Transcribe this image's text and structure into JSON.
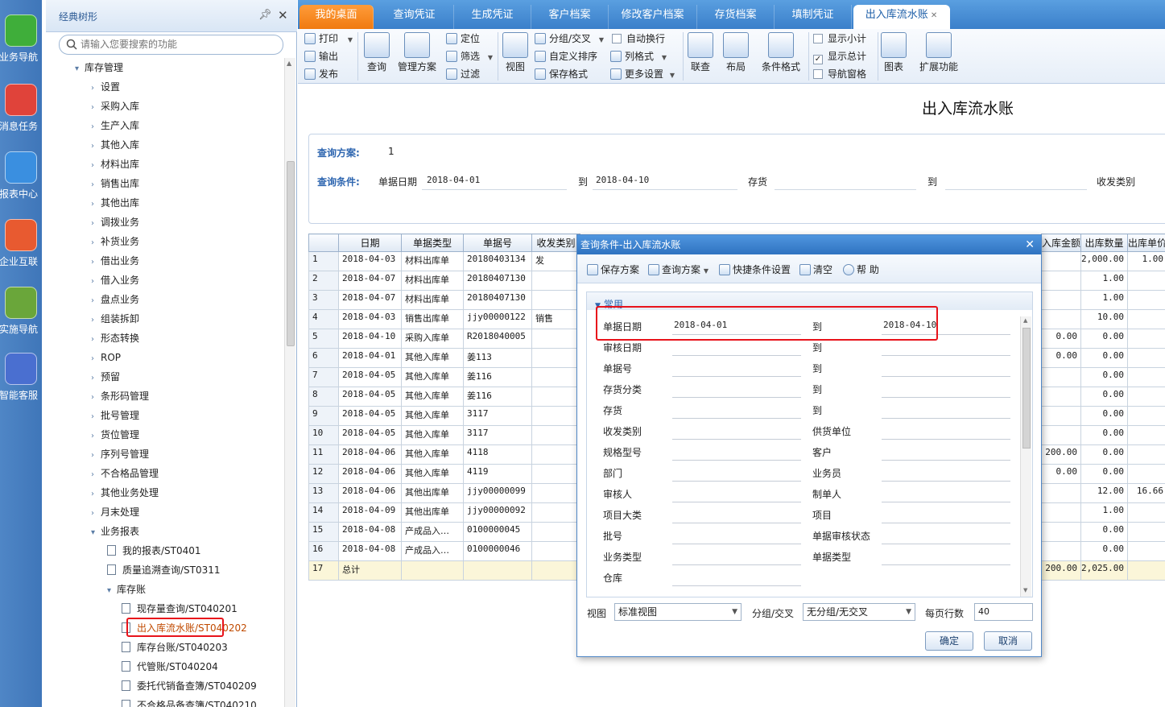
{
  "farleft": [
    {
      "label": "业务导航",
      "icon": "grid-icon",
      "color": "#3fae3a"
    },
    {
      "label": "消息任务",
      "icon": "mail-icon",
      "color": "#e0433a"
    },
    {
      "label": "报表中心",
      "icon": "report-icon",
      "color": "#3a8fe0"
    },
    {
      "label": "企业互联",
      "icon": "link-icon",
      "color": "#e85a30"
    },
    {
      "label": "实施导航",
      "icon": "compass-icon",
      "color": "#6aa63a"
    },
    {
      "label": "智能客服",
      "icon": "headset-icon",
      "color": "#4a6fd0"
    }
  ],
  "tree": {
    "title": "经典树形",
    "search_placeholder": "请输入您要搜索的功能",
    "root": "库存管理",
    "items": [
      "设置",
      "采购入库",
      "生产入库",
      "其他入库",
      "材料出库",
      "销售出库",
      "其他出库",
      "调拨业务",
      "补货业务",
      "借出业务",
      "借入业务",
      "盘点业务",
      "组装拆卸",
      "形态转换",
      "ROP",
      "预留",
      "条形码管理",
      "批号管理",
      "货位管理",
      "序列号管理",
      "不合格品管理",
      "其他业务处理",
      "月末处理"
    ],
    "reports": "业务报表",
    "report_items": [
      "我的报表/ST0401",
      "质量追溯查询/ST0311"
    ],
    "ledger": "库存账",
    "ledger_items": [
      "现存量查询/ST040201",
      "出入库流水账/ST040202",
      "库存台账/ST040203",
      "代管账/ST040204",
      "委托代销备查簿/ST040209",
      "不合格品备查簿/ST040210"
    ]
  },
  "tabs": [
    "我的桌面",
    "查询凭证",
    "生成凭证",
    "客户档案",
    "修改客户档案",
    "存货档案",
    "填制凭证",
    "出入库流水账"
  ],
  "ribbon": {
    "print": "打印",
    "export": "输出",
    "publish": "发布",
    "query": "查询",
    "manage_scheme": "管理方案",
    "locate": "定位",
    "filter": "筛选",
    "filter2": "过滤",
    "view": "视图",
    "group": "分组/交叉",
    "custom_sort": "自定义排序",
    "save_format": "保存格式",
    "auto_wrap": "自动换行",
    "col_format": "列格式",
    "more_settings": "更多设置",
    "link_query": "联查",
    "layout": "布局",
    "cond_format": "条件格式",
    "show_subtotal": "显示小计",
    "show_total": "显示总计",
    "nav_pane": "导航窗格",
    "chart": "图表",
    "extend": "扩展功能"
  },
  "page_title": "出入库流水账",
  "query": {
    "scheme_label": "查询方案:",
    "scheme_value": "1",
    "cond_label": "查询条件:",
    "date_label": "单据日期",
    "date_from": "2018-04-01",
    "to": "到",
    "date_to": "2018-04-10",
    "inv_label": "存货",
    "to2": "到",
    "type_label": "收发类别"
  },
  "grid": {
    "headers": [
      "",
      "日期",
      "单据类型",
      "单据号",
      "收发类别"
    ],
    "right_headers": [
      "入库金额",
      "出库数量",
      "出库单价"
    ],
    "rows": [
      {
        "n": "1",
        "date": "2018-04-03",
        "type": "材料出库单",
        "no": "20180403134",
        "cat": "发",
        "amt": "",
        "qty": "2,000.00",
        "price": "1.00"
      },
      {
        "n": "2",
        "date": "2018-04-07",
        "type": "材料出库单",
        "no": "20180407130",
        "cat": "",
        "amt": "",
        "qty": "1.00",
        "price": ""
      },
      {
        "n": "3",
        "date": "2018-04-07",
        "type": "材料出库单",
        "no": "20180407130",
        "cat": "",
        "amt": "",
        "qty": "1.00",
        "price": ""
      },
      {
        "n": "4",
        "date": "2018-04-03",
        "type": "销售出库单",
        "no": "jjy00000122",
        "cat": "销售",
        "amt": "",
        "qty": "10.00",
        "price": ""
      },
      {
        "n": "5",
        "date": "2018-04-10",
        "type": "采购入库单",
        "no": "R2018040005",
        "cat": "",
        "amt": "0.00",
        "qty": "0.00",
        "price": ""
      },
      {
        "n": "6",
        "date": "2018-04-01",
        "type": "其他入库单",
        "no": "姜113",
        "cat": "",
        "amt": "0.00",
        "qty": "0.00",
        "price": ""
      },
      {
        "n": "7",
        "date": "2018-04-05",
        "type": "其他入库单",
        "no": "姜116",
        "cat": "",
        "amt": "",
        "qty": "0.00",
        "price": ""
      },
      {
        "n": "8",
        "date": "2018-04-05",
        "type": "其他入库单",
        "no": "姜116",
        "cat": "",
        "amt": "",
        "qty": "0.00",
        "price": ""
      },
      {
        "n": "9",
        "date": "2018-04-05",
        "type": "其他入库单",
        "no": "3117",
        "cat": "",
        "amt": "",
        "qty": "0.00",
        "price": ""
      },
      {
        "n": "10",
        "date": "2018-04-05",
        "type": "其他入库单",
        "no": "3117",
        "cat": "",
        "amt": "",
        "qty": "0.00",
        "price": ""
      },
      {
        "n": "11",
        "date": "2018-04-06",
        "type": "其他入库单",
        "no": "4118",
        "cat": "",
        "amt": "200.00",
        "qty": "0.00",
        "price": ""
      },
      {
        "n": "12",
        "date": "2018-04-06",
        "type": "其他入库单",
        "no": "4119",
        "cat": "",
        "amt": "0.00",
        "qty": "0.00",
        "price": ""
      },
      {
        "n": "13",
        "date": "2018-04-06",
        "type": "其他出库单",
        "no": "jjy00000099",
        "cat": "",
        "amt": "",
        "qty": "12.00",
        "price": "16.66"
      },
      {
        "n": "14",
        "date": "2018-04-09",
        "type": "其他出库单",
        "no": "jjy00000092",
        "cat": "",
        "amt": "",
        "qty": "1.00",
        "price": ""
      },
      {
        "n": "15",
        "date": "2018-04-08",
        "type": "产成品入…",
        "no": "0100000045",
        "cat": "",
        "amt": "",
        "qty": "0.00",
        "price": ""
      },
      {
        "n": "16",
        "date": "2018-04-08",
        "type": "产成品入…",
        "no": "0100000046",
        "cat": "",
        "amt": "",
        "qty": "0.00",
        "price": ""
      },
      {
        "n": "17",
        "date": "总计",
        "type": "",
        "no": "",
        "cat": "",
        "amt": "200.00",
        "qty": "2,025.00",
        "price": ""
      }
    ]
  },
  "dialog": {
    "title": "查询条件-出入库流水账",
    "save_scheme": "保存方案",
    "query_scheme": "查询方案",
    "quick_settings": "快捷条件设置",
    "clear": "清空",
    "help": "帮 助",
    "section": "常用",
    "fields": [
      {
        "l": "单据日期",
        "v": "2018-04-01",
        "r": "到",
        "rv": "2018-04-10"
      },
      {
        "l": "审核日期",
        "v": "",
        "r": "到",
        "rv": ""
      },
      {
        "l": "单据号",
        "v": "",
        "r": "到",
        "rv": ""
      },
      {
        "l": "存货分类",
        "v": "",
        "r": "到",
        "rv": ""
      },
      {
        "l": "存货",
        "v": "",
        "r": "到",
        "rv": ""
      },
      {
        "l": "收发类别",
        "v": "",
        "r": "供货单位",
        "rv": ""
      },
      {
        "l": "规格型号",
        "v": "",
        "r": "客户",
        "rv": ""
      },
      {
        "l": "部门",
        "v": "",
        "r": "业务员",
        "rv": ""
      },
      {
        "l": "审核人",
        "v": "",
        "r": "制单人",
        "rv": ""
      },
      {
        "l": "项目大类",
        "v": "",
        "r": "项目",
        "rv": ""
      },
      {
        "l": "批号",
        "v": "",
        "r": "单据审核状态",
        "rv": ""
      },
      {
        "l": "业务类型",
        "v": "",
        "r": "单据类型",
        "rv": ""
      },
      {
        "l": "仓库",
        "v": "",
        "r": "",
        "rv": ""
      }
    ],
    "view_label": "视图",
    "view_value": "标准视图",
    "group_label": "分组/交叉",
    "group_value": "无分组/无交叉",
    "rows_label": "每页行数",
    "rows_value": "40",
    "ok": "确定",
    "cancel": "取消"
  }
}
